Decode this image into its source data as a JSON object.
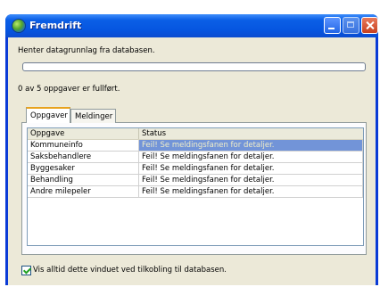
{
  "window": {
    "title": "Fremdrift",
    "minimize_icon": "minimize-icon",
    "maximize_icon": "maximize-icon",
    "close_icon": "close-icon"
  },
  "status": {
    "message": "Henter datagrunnlag fra databasen.",
    "progress_fraction": 0,
    "task_count": "0 av 5 oppgaver er fullført."
  },
  "tabs": [
    {
      "label": "Oppgaver",
      "active": true
    },
    {
      "label": "Meldinger",
      "active": false
    }
  ],
  "table": {
    "columns": [
      "Oppgave",
      "Status"
    ],
    "rows": [
      {
        "task": "Kommuneinfo",
        "status": "Feil! Se meldingsfanen for detaljer.",
        "selected": true
      },
      {
        "task": "Saksbehandlere",
        "status": "Feil! Se meldingsfanen for detaljer.",
        "selected": false
      },
      {
        "task": "Byggesaker",
        "status": "Feil! Se meldingsfanen for detaljer.",
        "selected": false
      },
      {
        "task": "Behandling",
        "status": "Feil! Se meldingsfanen for detaljer.",
        "selected": false
      },
      {
        "task": "Andre milepeler",
        "status": "Feil! Se meldingsfanen for detaljer.",
        "selected": false
      }
    ]
  },
  "checkbox": {
    "label": "Vis alltid dette vinduet ved tilkobling til databasen.",
    "checked": true
  },
  "colors": {
    "titlebar": "#0655e0",
    "selection": "#7294d8",
    "active_tab_accent": "#e8a21e"
  }
}
